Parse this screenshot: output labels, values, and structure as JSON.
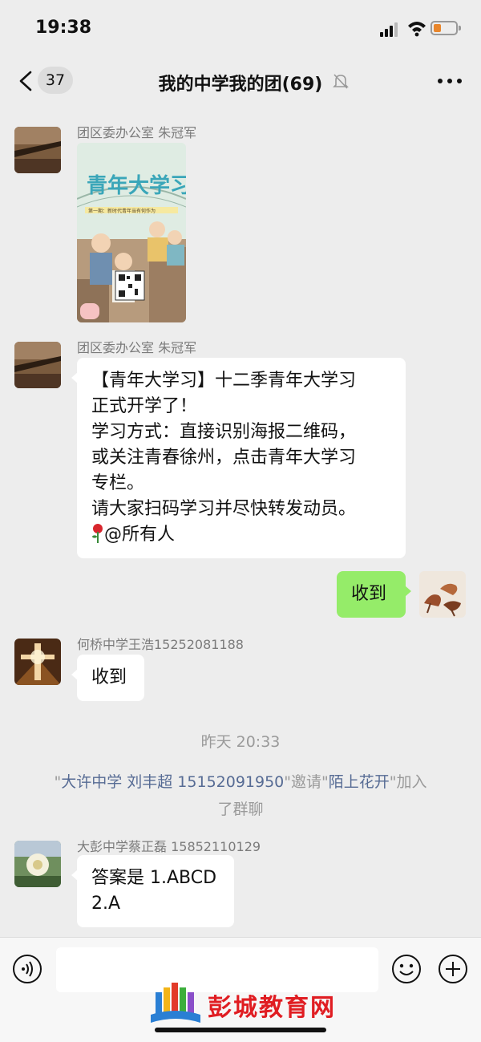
{
  "status_bar": {
    "time": "19:38"
  },
  "nav": {
    "back_count": "37",
    "title": "我的中学我的团(69)"
  },
  "messages": [
    {
      "sender": "团区委办公室 朱冠军",
      "type": "image",
      "poster": {
        "title": "青年大学习",
        "subtitle": "第一期：新时代青年当有何作为"
      }
    },
    {
      "sender": "团区委办公室 朱冠军",
      "type": "text",
      "lines": [
        "【青年大学习】十二季青年大学习",
        "正式开学了！",
        "学习方式：直接识别海报二维码，",
        "或关注青春徐州，点击青年大学习",
        "专栏。",
        "请大家扫码学习并尽快转发动员。",
        "@所有人"
      ]
    },
    {
      "sender": "",
      "type": "text",
      "mine": true,
      "text": "收到"
    },
    {
      "sender": "何桥中学王浩15252081188",
      "type": "text",
      "text": "收到"
    }
  ],
  "system": {
    "time": "昨天 20:33",
    "invite": {
      "q1": "\"",
      "inviter": "大许中学  刘丰超 15152091950",
      "mid": "\"邀请\"",
      "invitee": "陌上花开",
      "end": "\"加入",
      "line2": "了群聊"
    }
  },
  "last_message": {
    "sender": "大彭中学蔡正磊 15852110129",
    "lines": [
      "答案是 1.ABCD",
      "2.A"
    ]
  },
  "watermark": {
    "text": "彭城教育网"
  }
}
